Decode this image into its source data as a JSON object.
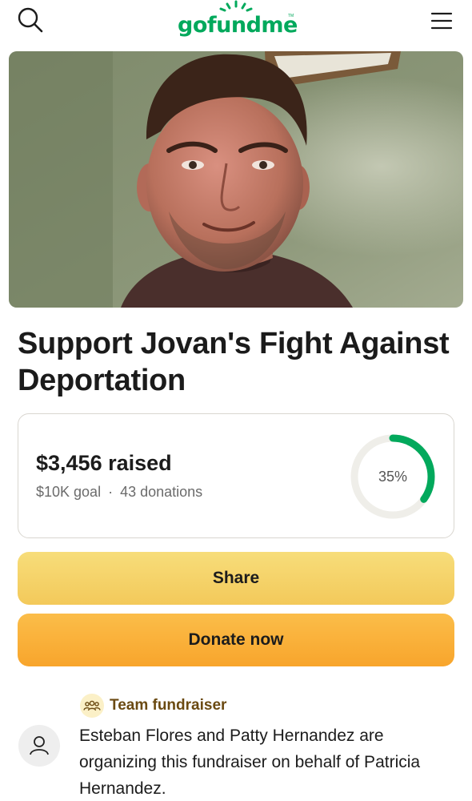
{
  "header": {
    "logo_text": "gofundme",
    "logo_tm": "TM",
    "search_icon": "search-icon",
    "menu_icon": "hamburger-menu-icon",
    "brand_color": "#02a95c"
  },
  "campaign": {
    "title": "Support Jovan's Fight Against Deportation",
    "raised": "$3,456 raised",
    "goal": "$10K goal",
    "separator": "·",
    "donations": "43 donations",
    "progress_label": "35%",
    "progress_fraction": 0.35,
    "ring_color": "#02a95c",
    "ring_track_color": "#efeee9"
  },
  "actions": {
    "share_label": "Share",
    "donate_label": "Donate now"
  },
  "organizer": {
    "team_label": "Team fundraiser",
    "team_icon": "team-people-icon",
    "avatar_icon": "user-icon",
    "text": "Esteban Flores and Patty Hernandez are organizing this fundraiser on behalf of Patricia Hernandez."
  }
}
